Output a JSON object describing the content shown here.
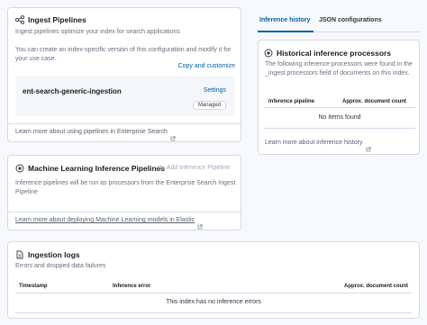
{
  "ingest_pipelines": {
    "title": "Ingest Pipelines",
    "subtitle": "Ingest pipelines optimize your index for search applications",
    "description": "You can create an index-specific version of this configuration and modify it for your use case.",
    "copy_customize_label": "Copy and customize",
    "pipeline": {
      "name": "ent-search-generic-ingestion",
      "settings_label": "Settings",
      "badge": "Managed"
    },
    "learn_more": "Learn more about using pipelines in Enterprise Search"
  },
  "ml_pipelines": {
    "title": "Machine Learning Inference Pipelines",
    "add_label": "Add Inference Pipeline",
    "description": "Inference pipelines will be run as processors from the Enterprise Search Ingest Pipeline",
    "learn_more": "Learn more about deploying Machine Learning models in Elastic"
  },
  "tabs": {
    "inference_history": "Inference history",
    "json_config": "JSON configurations"
  },
  "historical": {
    "title": "Historical inference processors",
    "description": "The following inference processors were found in the _ingest.processors field of documents on this index.",
    "col_pipeline": "Inference pipeline",
    "col_count": "Approx. document count",
    "empty": "No items found",
    "learn_more": "Learn more about inference history"
  },
  "logs": {
    "title": "Ingestion logs",
    "subtitle": "Errors and dropped data failures",
    "col_timestamp": "Timestamp",
    "col_error": "Inference error",
    "col_count": "Approx. document count",
    "empty": "This index has no inference errors"
  },
  "colors": {
    "link": "#0061a6",
    "border": "#d3dae6",
    "accent_tab": "#0061a6",
    "background": "#f7f8fc"
  }
}
